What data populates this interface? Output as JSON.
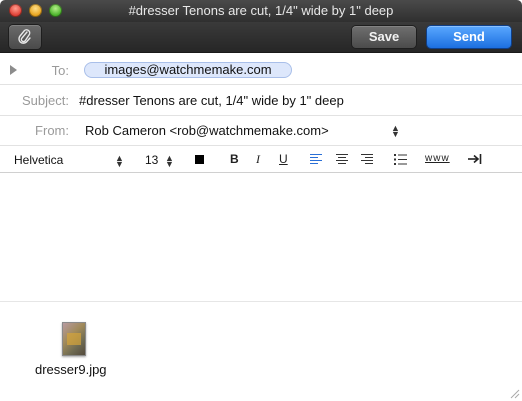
{
  "window": {
    "title": "#dresser Tenons are cut, 1/4\" wide by 1\" deep"
  },
  "toolbar": {
    "attach_icon": "paperclip-icon",
    "save_label": "Save",
    "send_label": "Send",
    "send_color": "#1c6fe0"
  },
  "header": {
    "to_label": "To:",
    "to_recipient": "images@watchmemake.com",
    "subject_label": "Subject:",
    "subject_value": "#dresser Tenons are cut, 1/4\" wide by 1\" deep",
    "from_label": "From:",
    "from_value": "Rob Cameron <rob@watchmemake.com>"
  },
  "format": {
    "font_family": "Helvetica",
    "font_size": "13",
    "bold_label": "B",
    "italic_label": "I",
    "underline_label": "U",
    "link_label": "www",
    "active_align": "align-left"
  },
  "attachment": {
    "filename": "dresser9.jpg"
  }
}
